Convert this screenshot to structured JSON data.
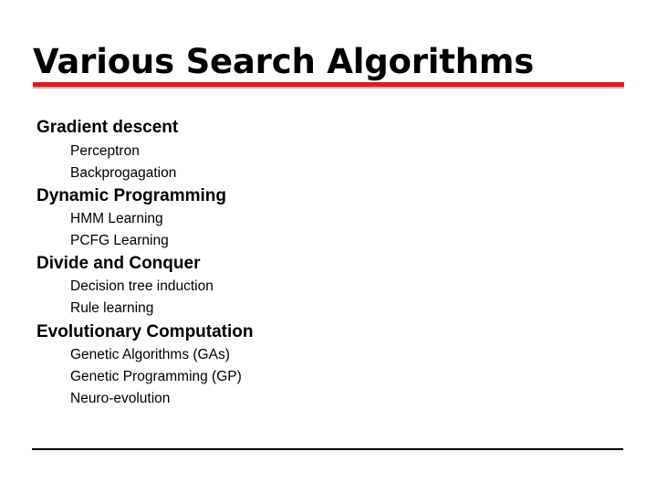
{
  "slide": {
    "title": "Various Search Algorithms",
    "accent_color": "#e01b1b",
    "accent_shadow_color": "#d9a7a7",
    "rule_color": "#000000",
    "background_color": "#ffffff",
    "text_color": "#000000"
  },
  "groups": [
    {
      "heading": "Gradient descent",
      "items": [
        {
          "label": "Perceptron"
        },
        {
          "label": "Backprogagation"
        }
      ]
    },
    {
      "heading": "Dynamic Programming",
      "items": [
        {
          "label": "HMM Learning"
        },
        {
          "label": "PCFG Learning"
        }
      ]
    },
    {
      "heading": "Divide and Conquer",
      "items": [
        {
          "label": "Decision tree induction"
        },
        {
          "label": "Rule learning"
        }
      ]
    },
    {
      "heading": "Evolutionary Computation",
      "items": [
        {
          "label": "Genetic Algorithms (GAs)"
        },
        {
          "label": "Genetic Programming (GP)"
        },
        {
          "label": "Neuro-evolution"
        }
      ]
    }
  ]
}
